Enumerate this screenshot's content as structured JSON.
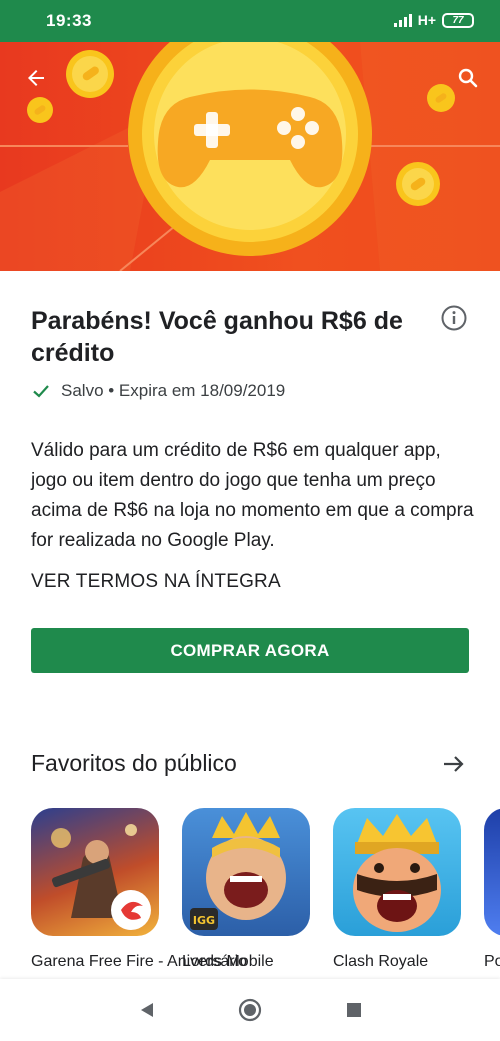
{
  "status_bar": {
    "time": "19:33",
    "network": "H+",
    "battery": "77"
  },
  "hero": {
    "back_icon": "arrow-back-icon",
    "search_icon": "search-icon",
    "illustration": "gamepad-coin-icon",
    "colors": {
      "background": "#ee4a1e",
      "coin": "#f9c51c",
      "pad": "#f7a823"
    }
  },
  "offer": {
    "title": "Parabéns! Você ganhou R$6 de crédito",
    "saved_text": "Salvo • Expira em 18/09/2019",
    "description": "Válido para um crédito de R$6 em qualquer app, jogo ou item dentro do jogo que tenha um preço acima de R$6 na loja no momento em que a compra for realizada no Google Play.",
    "terms_link": "VER TERMOS NA ÍNTEGRA",
    "buy_button": "COMPRAR AGORA"
  },
  "favorites": {
    "title": "Favoritos do público",
    "apps": [
      {
        "name": "Garena Free Fire - Aniversário"
      },
      {
        "name": "Lords Mobile"
      },
      {
        "name": "Clash Royale"
      },
      {
        "name": "Po"
      }
    ]
  },
  "colors": {
    "accent": "#1f8a4c",
    "text": "#202124"
  }
}
